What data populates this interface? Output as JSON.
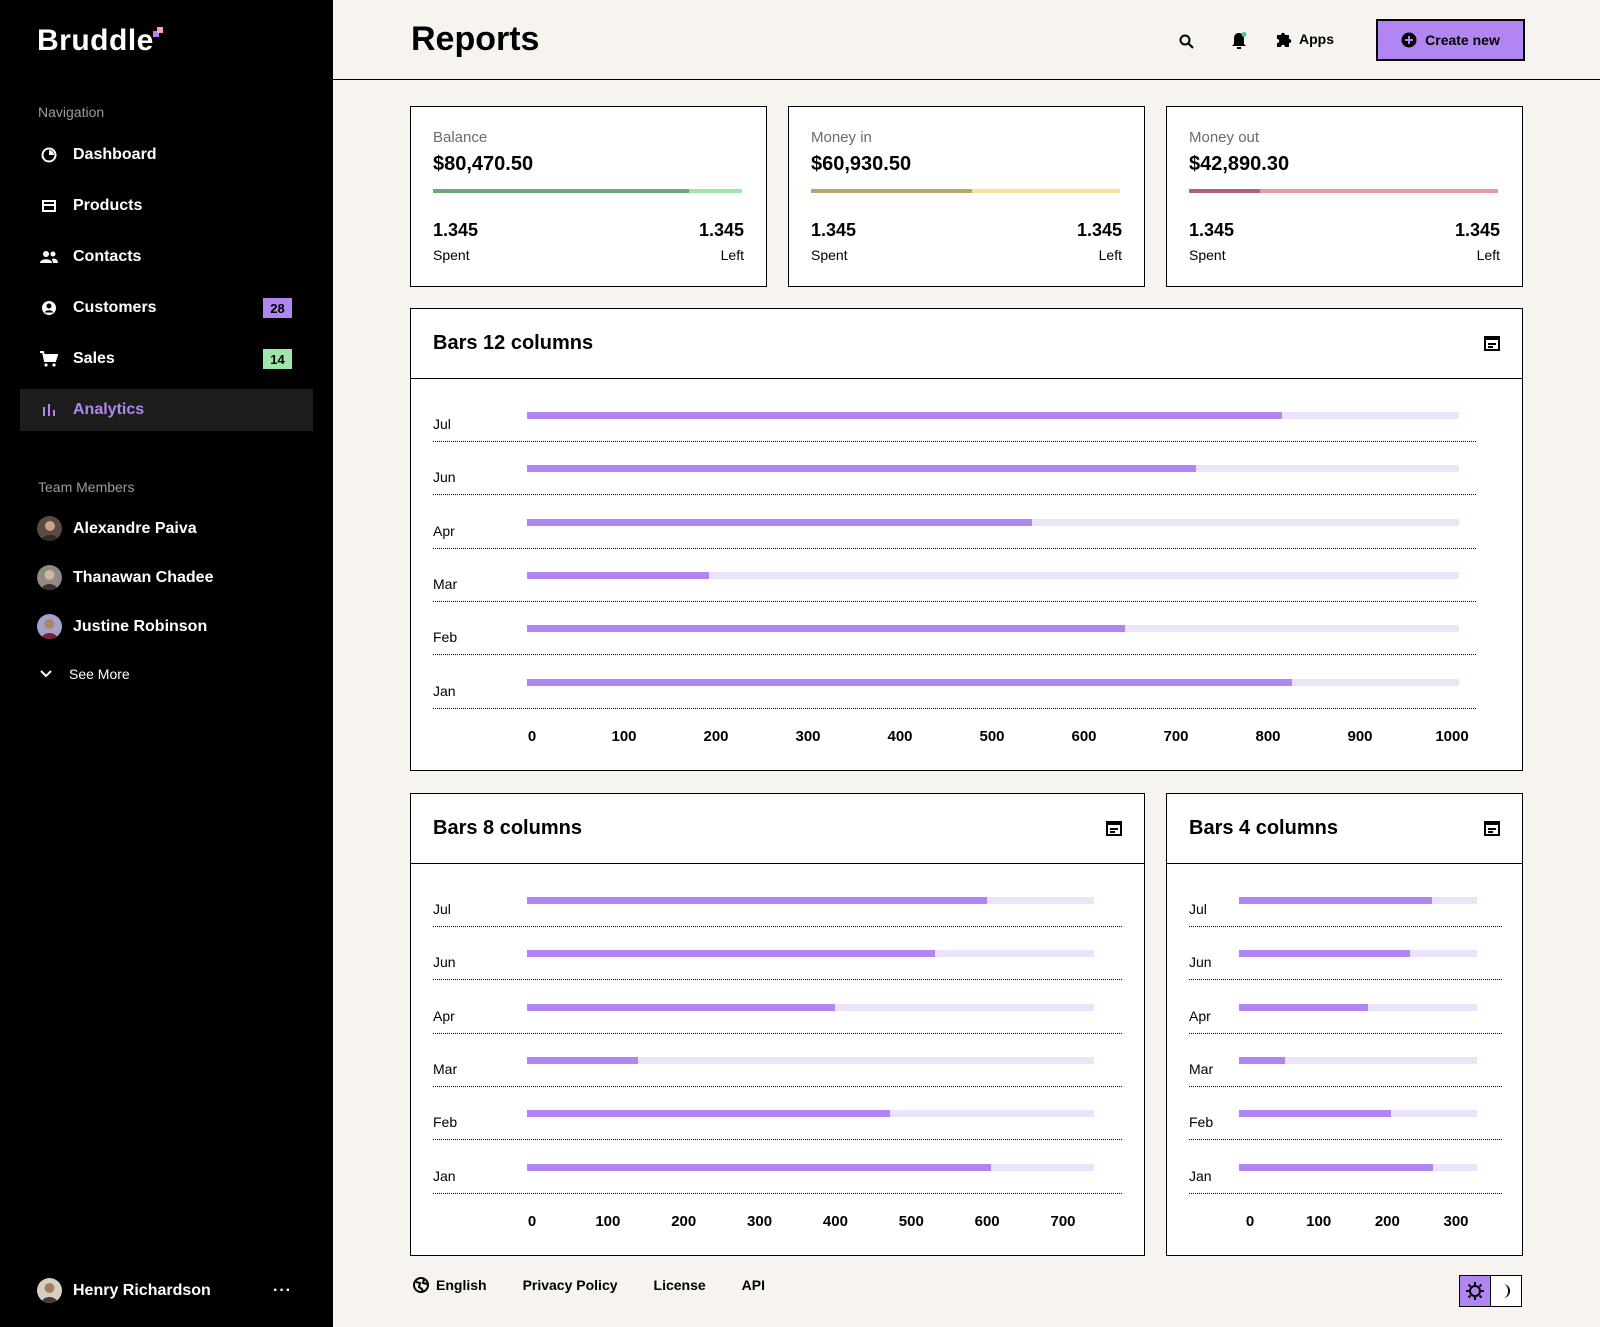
{
  "brand": {
    "name": "Bruddle"
  },
  "nav": {
    "title": "Navigation",
    "items": [
      {
        "label": "Dashboard"
      },
      {
        "label": "Products"
      },
      {
        "label": "Contacts"
      },
      {
        "label": "Customers",
        "badge": "28"
      },
      {
        "label": "Sales",
        "badge": "14"
      },
      {
        "label": "Analytics"
      }
    ]
  },
  "team": {
    "title": "Team Members",
    "members": [
      {
        "name": "Alexandre Paiva"
      },
      {
        "name": "Thanawan Chadee"
      },
      {
        "name": "Justine Robinson"
      }
    ],
    "see_more": "See More"
  },
  "current_user": {
    "name": "Henry Richardson",
    "menu": "···"
  },
  "header": {
    "title": "Reports",
    "apps_label": "Apps",
    "create_label": "Create new"
  },
  "stats": [
    {
      "label": "Balance",
      "value": "$80,470.50",
      "spent": "1.345",
      "spent_label": "Spent",
      "left": "1.345",
      "left_label": "Left",
      "progress": 0.83,
      "color_dark": "#6aa779",
      "color_light": "#9ee6a9"
    },
    {
      "label": "Money in",
      "value": "$60,930.50",
      "spent": "1.345",
      "spent_label": "Spent",
      "left": "1.345",
      "left_label": "Left",
      "progress": 0.52,
      "color_dark": "#b3a56b",
      "color_light": "#f6e397"
    },
    {
      "label": "Money out",
      "value": "$42,890.30",
      "spent": "1.345",
      "spent_label": "Spent",
      "left": "1.345",
      "left_label": "Left",
      "progress": 0.23,
      "color_dark": "#ad6370",
      "color_light": "#e89aa0"
    }
  ],
  "charts": [
    {
      "title": "Bars 12 columns"
    },
    {
      "title": "Bars 8 columns"
    },
    {
      "title": "Bars 4 columns"
    }
  ],
  "chart_data": [
    {
      "type": "bar",
      "title": "Bars 12 columns",
      "orientation": "horizontal",
      "categories": [
        "Jul",
        "Jun",
        "Apr",
        "Mar",
        "Feb",
        "Jan"
      ],
      "values": [
        830,
        735,
        555,
        200,
        657,
        840
      ],
      "max": 1024,
      "xlim": [
        0,
        1000
      ],
      "xticks": [
        "0",
        "100",
        "200",
        "300",
        "400",
        "500",
        "600",
        "700",
        "800",
        "900",
        "1000"
      ]
    },
    {
      "type": "bar",
      "title": "Bars 8 columns",
      "orientation": "horizontal",
      "categories": [
        "Jul",
        "Jun",
        "Apr",
        "Mar",
        "Feb",
        "Jan"
      ],
      "values": [
        600,
        532,
        402,
        145,
        474,
        606
      ],
      "max": 740,
      "xlim": [
        0,
        700
      ],
      "xticks": [
        "0",
        "100",
        "200",
        "300",
        "400",
        "500",
        "600",
        "700"
      ]
    },
    {
      "type": "bar",
      "title": "Bars 4 columns",
      "orientation": "horizontal",
      "categories": [
        "Jul",
        "Jun",
        "Apr",
        "Mar",
        "Feb",
        "Jan"
      ],
      "values": [
        271,
        240,
        181,
        65,
        214,
        272
      ],
      "max": 334,
      "xlim": [
        0,
        300
      ],
      "xticks": [
        "0",
        "100",
        "200",
        "300"
      ]
    }
  ],
  "footer": {
    "language": "English",
    "links": [
      "Privacy Policy",
      "License",
      "API"
    ]
  },
  "colors": {
    "accent": "#b286f2",
    "accent_light": "#ece3fb",
    "badge_purple": "#b286f2",
    "badge_green": "#9ee6a9",
    "sidebar": "#000000",
    "background": "#f7f4ef"
  }
}
